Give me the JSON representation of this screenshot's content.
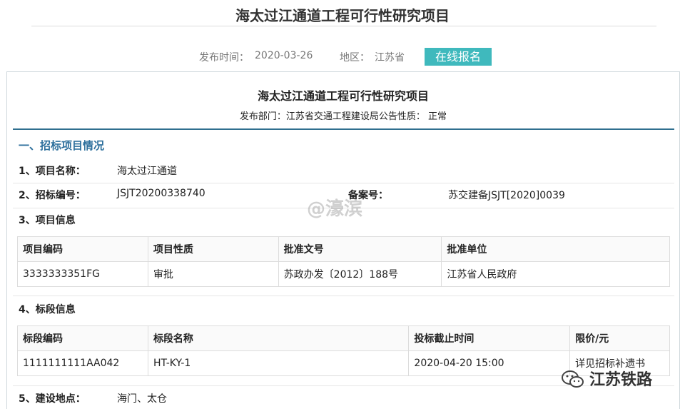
{
  "page": {
    "title": "海太过江通道工程可行性研究项目",
    "publish_time_label": "发布时间：",
    "publish_time": "2020-03-26",
    "region_label": "地区：",
    "region": "江苏省",
    "online_button": "在线报名"
  },
  "doc": {
    "title": "海太过江通道工程可行性研究项目",
    "subtitle": "发布部门：江苏省交通工程建设局公告性质：  正常"
  },
  "section1": {
    "title": "一、招标项目情况"
  },
  "fields": {
    "project_name_label": "1、项目名称：",
    "project_name": "海太过江通道",
    "bid_no_label": "2、招标编号：",
    "bid_no": "JSJT20200338740",
    "record_label": "备案号：",
    "record_no": "苏交建备JSJT[2020]0039",
    "project_info_label": "3、项目信息",
    "section_info_label": "4、标段信息",
    "location_label": "5、建设地点：",
    "location": "海门、太仓"
  },
  "project_table": {
    "headers": [
      "项目编码",
      "项目性质",
      "批准文号",
      "批准单位"
    ],
    "rows": [
      [
        "3333333351FG",
        "审批",
        "苏政办发〔2012〕188号",
        "江苏省人民政府"
      ]
    ]
  },
  "section_table": {
    "headers": [
      "标段编码",
      "标段名称",
      "投标截止时间",
      "限价/元"
    ],
    "rows": [
      [
        "1111111111AA042",
        "HT-KY-1",
        "2020-04-20 15:00",
        "详见招标补遗书"
      ]
    ]
  },
  "overlays": {
    "watermark": "@濠滨",
    "brand": "江苏铁路"
  }
}
